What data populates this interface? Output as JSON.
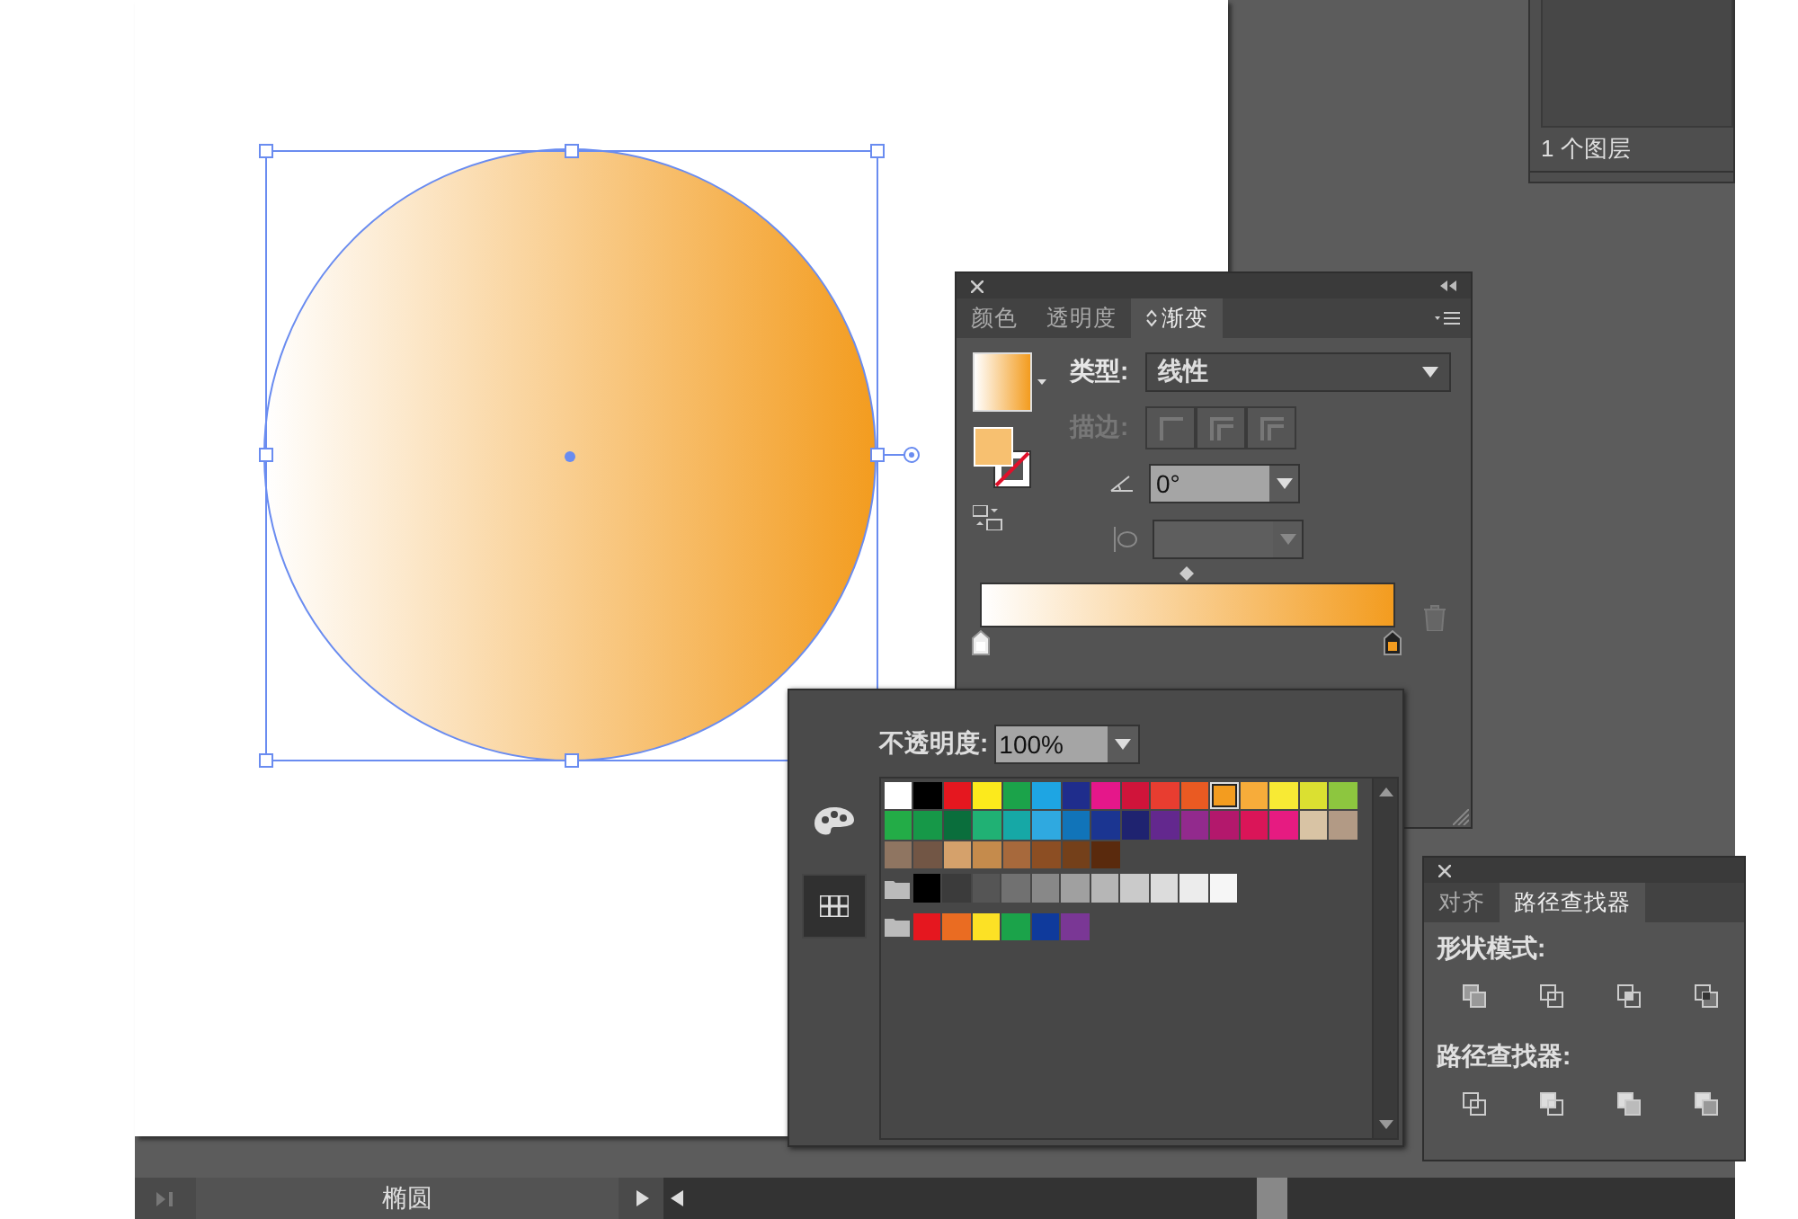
{
  "layers_panel": {
    "status": "1 个图层"
  },
  "gradient_panel": {
    "tabs": [
      {
        "label": "颜色",
        "selected": false
      },
      {
        "label": "透明度",
        "selected": false
      },
      {
        "label": "渐变",
        "selected": true
      }
    ],
    "type_label": "类型:",
    "type_value": "线性",
    "stroke_label": "描边:",
    "stroke_disabled": true,
    "angle_value": "0°",
    "aspect_disabled": true,
    "stops": [
      {
        "color": "#ffffff",
        "selected": false
      },
      {
        "color": "#f39c1f",
        "selected": true
      }
    ]
  },
  "swatches_popup": {
    "opacity_label": "不透明度:",
    "opacity_value": "100%",
    "views": [
      {
        "kind": "palette",
        "selected": false
      },
      {
        "kind": "grid",
        "selected": true
      }
    ],
    "rows": [
      {
        "kind": "plain",
        "swatches": [
          {
            "color": "#ffffff",
            "selected": false
          },
          {
            "color": "#000000",
            "selected": false
          },
          {
            "color": "#e5171f",
            "selected": false
          },
          {
            "color": "#fcea1c",
            "selected": false
          },
          {
            "color": "#1ba34a",
            "selected": false
          },
          {
            "color": "#1ea5e3",
            "selected": false
          },
          {
            "color": "#1f2d8c",
            "selected": false
          },
          {
            "color": "#e5178a",
            "selected": false
          },
          {
            "color": "#d0143a",
            "selected": false
          },
          {
            "color": "#e83d30",
            "selected": false
          },
          {
            "color": "#ea5a22",
            "selected": false
          },
          {
            "color": "#f39c1f",
            "selected": true
          },
          {
            "color": "#f7ac3a",
            "selected": false
          },
          {
            "color": "#f8ea34",
            "selected": false
          },
          {
            "color": "#dbe031",
            "selected": false
          },
          {
            "color": "#8dc63f",
            "selected": false
          }
        ]
      },
      {
        "kind": "plain",
        "swatches": [
          {
            "color": "#23ac47",
            "selected": false
          },
          {
            "color": "#169848",
            "selected": false
          },
          {
            "color": "#0a6e3c",
            "selected": false
          },
          {
            "color": "#20b174",
            "selected": false
          },
          {
            "color": "#16a8a6",
            "selected": false
          },
          {
            "color": "#2fa9e0",
            "selected": false
          },
          {
            "color": "#1174b9",
            "selected": false
          },
          {
            "color": "#1b3591",
            "selected": false
          },
          {
            "color": "#1f2370",
            "selected": false
          },
          {
            "color": "#63288e",
            "selected": false
          },
          {
            "color": "#922a8d",
            "selected": false
          },
          {
            "color": "#b3186c",
            "selected": false
          },
          {
            "color": "#da1558",
            "selected": false
          },
          {
            "color": "#e61b81",
            "selected": false
          },
          {
            "color": "#d8c3a4",
            "selected": false
          },
          {
            "color": "#b29a85",
            "selected": false
          }
        ]
      },
      {
        "kind": "plain",
        "swatches": [
          {
            "color": "#8f7561",
            "selected": false
          },
          {
            "color": "#725645",
            "selected": false
          },
          {
            "color": "#d5a16b",
            "selected": false
          },
          {
            "color": "#c58b4c",
            "selected": false
          },
          {
            "color": "#a7693c",
            "selected": false
          },
          {
            "color": "#8c4e23",
            "selected": false
          },
          {
            "color": "#74401a",
            "selected": false
          },
          {
            "color": "#5a2a0d",
            "selected": false
          }
        ]
      },
      {
        "kind": "group",
        "swatches": [
          {
            "color": "#000000",
            "selected": false
          },
          {
            "color": "#3b3b3b",
            "selected": false
          },
          {
            "color": "#555555",
            "selected": false
          },
          {
            "color": "#717171",
            "selected": false
          },
          {
            "color": "#888888",
            "selected": false
          },
          {
            "color": "#a0a0a0",
            "selected": false
          },
          {
            "color": "#b6b6b6",
            "selected": false
          },
          {
            "color": "#cacaca",
            "selected": false
          },
          {
            "color": "#dcdcdc",
            "selected": false
          },
          {
            "color": "#ececec",
            "selected": false
          },
          {
            "color": "#f6f6f6",
            "selected": false
          }
        ]
      },
      {
        "kind": "group",
        "swatches": [
          {
            "color": "#e5171f",
            "selected": false
          },
          {
            "color": "#ea6c22",
            "selected": false
          },
          {
            "color": "#fce125",
            "selected": false
          },
          {
            "color": "#1ba34a",
            "selected": false
          },
          {
            "color": "#0f3a9c",
            "selected": false
          },
          {
            "color": "#7a3795",
            "selected": false
          }
        ]
      }
    ]
  },
  "pathfinder_panel": {
    "tabs": [
      {
        "label": "对齐",
        "selected": false
      },
      {
        "label": "路径查找器",
        "selected": true
      }
    ],
    "shape_modes_label": "形状模式:",
    "pathfinders_label": "路径查找器:"
  },
  "status_bar": {
    "tool_name": "椭圆"
  }
}
